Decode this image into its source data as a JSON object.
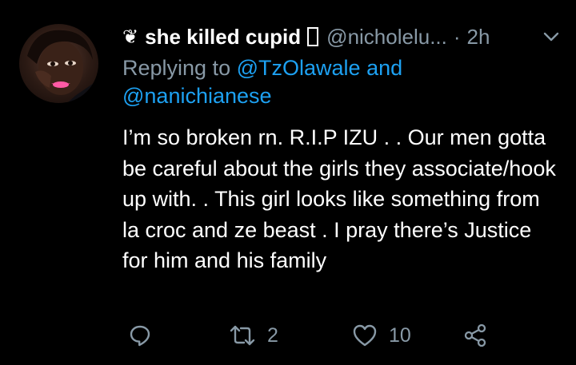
{
  "tweet": {
    "author": {
      "flower_icon": "❦",
      "display_name": "she killed cupid",
      "handle": "@nicholelu...",
      "avatar": "profile-photo"
    },
    "separator": "·",
    "timestamp": "2h",
    "replying_to": {
      "prefix": "Replying to",
      "mention1": "@TzOlawale",
      "and": "and",
      "mention2": "@nanichianese"
    },
    "text": "I’m so broken rn. R.I.P IZU . . Our men gotta be careful about the girls they associate/hook up with. . This girl looks like something from la croc and ze beast . I pray there’s Justice for him and his family",
    "actions": {
      "reply_icon": "reply-icon",
      "retweet_icon": "retweet-icon",
      "retweet_count": "2",
      "like_icon": "heart-icon",
      "like_count": "10",
      "share_icon": "share-icon"
    }
  },
  "colors": {
    "background": "#000000",
    "text": "#ffffff",
    "secondary": "#8899a6",
    "link": "#1da1f2"
  }
}
